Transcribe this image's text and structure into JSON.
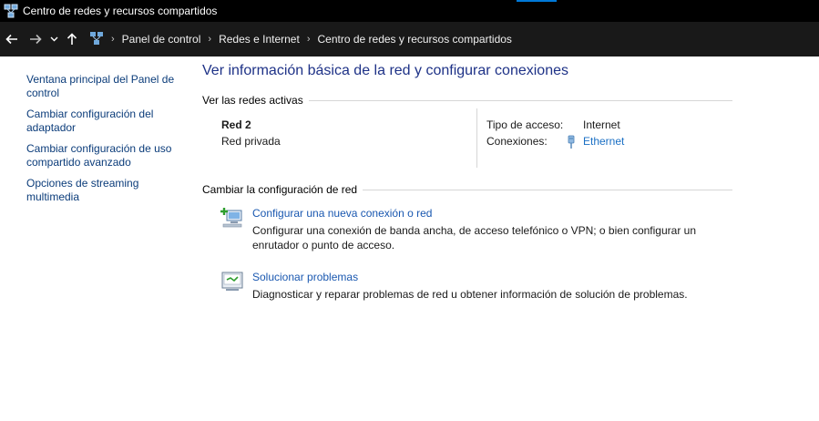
{
  "window": {
    "title": "Centro de redes y recursos compartidos",
    "accent_color": "#0078d7"
  },
  "address_bar": {
    "back_icon": "arrow-left",
    "forward_icon": "arrow-right",
    "recent_icon": "chevron-down",
    "up_icon": "arrow-up",
    "breadcrumbs": [
      "Panel de control",
      "Redes e Internet",
      "Centro de redes y recursos compartidos"
    ]
  },
  "sidebar": {
    "items": [
      {
        "label": "Ventana principal del Panel de control"
      },
      {
        "label": "Cambiar configuración del adaptador"
      },
      {
        "label": "Cambiar configuración de uso compartido avanzado"
      },
      {
        "label": "Opciones de streaming multimedia"
      }
    ]
  },
  "main": {
    "title": "Ver información básica de la red y configurar conexiones",
    "active_networks": {
      "heading": "Ver las redes activas",
      "network_name": "Red 2",
      "network_type": "Red privada",
      "access_label": "Tipo de acceso:",
      "access_value": "Internet",
      "connections_label": "Conexiones:",
      "connection_link": "Ethernet"
    },
    "change_settings": {
      "heading": "Cambiar la configuración de red",
      "tasks": [
        {
          "icon": "new-connection-icon",
          "link": "Configurar una nueva conexión o red",
          "description": "Configurar una conexión de banda ancha, de acceso telefónico o VPN; o bien configurar un enrutador o punto de acceso."
        },
        {
          "icon": "troubleshoot-icon",
          "link": "Solucionar problemas",
          "description": "Diagnosticar y reparar problemas de red u obtener información de solución de problemas."
        }
      ]
    }
  }
}
